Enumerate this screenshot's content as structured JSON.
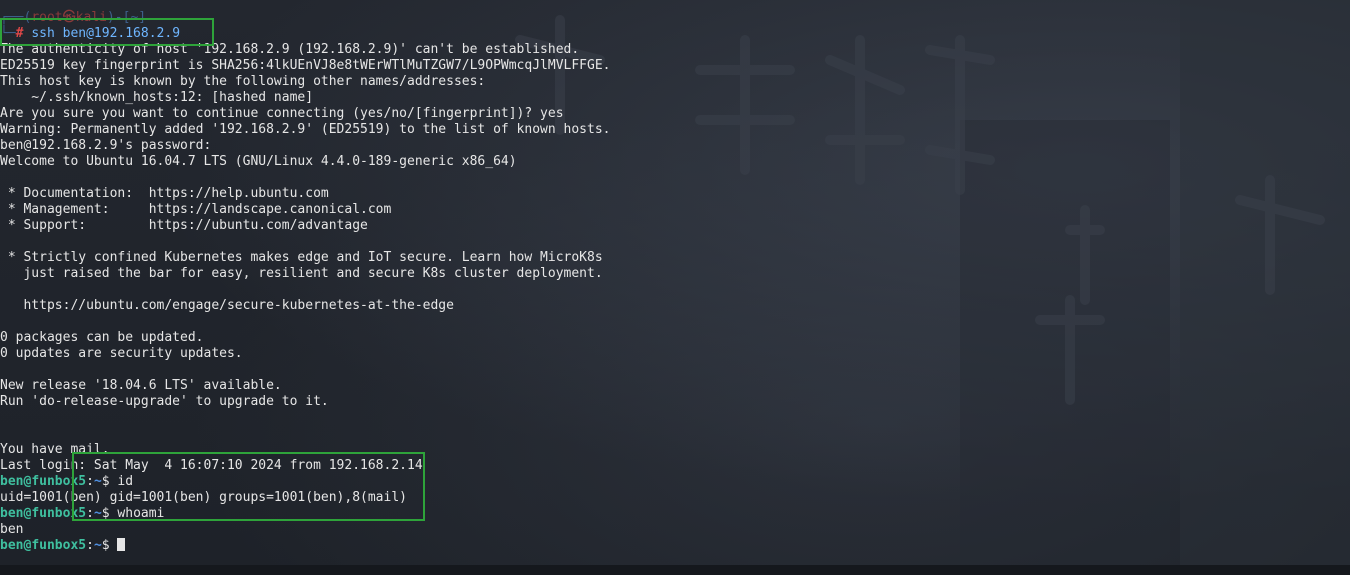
{
  "kali_prompt": {
    "open": "┌──(",
    "user": "root",
    "at": "㉿",
    "host": "kali",
    "close": ")-[",
    "dir": "~",
    "end": "]",
    "branch": "└─",
    "hash": "#",
    "command": "ssh ben@192.168.2.9"
  },
  "output": [
    "The authenticity of host '192.168.2.9 (192.168.2.9)' can't be established.",
    "ED25519 key fingerprint is SHA256:4lkUEnVJ8e8tWErWTlMuTZGW7/L9OPWmcqJlMVLFFGE.",
    "This host key is known by the following other names/addresses:",
    "    ~/.ssh/known_hosts:12: [hashed name]",
    "Are you sure you want to continue connecting (yes/no/[fingerprint])? yes",
    "Warning: Permanently added '192.168.2.9' (ED25519) to the list of known hosts.",
    "ben@192.168.2.9's password: ",
    "Welcome to Ubuntu 16.04.7 LTS (GNU/Linux 4.4.0-189-generic x86_64)",
    "",
    " * Documentation:  https://help.ubuntu.com",
    " * Management:     https://landscape.canonical.com",
    " * Support:        https://ubuntu.com/advantage",
    "",
    " * Strictly confined Kubernetes makes edge and IoT secure. Learn how MicroK8s",
    "   just raised the bar for easy, resilient and secure K8s cluster deployment.",
    "",
    "   https://ubuntu.com/engage/secure-kubernetes-at-the-edge",
    "",
    "0 packages can be updated.",
    "0 updates are security updates.",
    "",
    "New release '18.04.6 LTS' available.",
    "Run 'do-release-upgrade' to upgrade to it.",
    "",
    "",
    "You have mail.",
    "Last login: Sat May  4 16:07:10 2024 from 192.168.2.14"
  ],
  "ben_prompt": {
    "user": "ben",
    "at": "@",
    "host": "funbox5",
    "colon": ":",
    "path": "~",
    "sym": "$ "
  },
  "session": {
    "cmd_id": "id",
    "id_output": "uid=1001(ben) gid=1001(ben) groups=1001(ben),8(mail)",
    "cmd_whoami": "whoami",
    "whoami_output": "ben"
  },
  "colors": {
    "highlight_border": "#2ea33a",
    "prompt_green": "#3fbf9f",
    "kali_hash_red": "#e04848",
    "background": "#1c2027"
  }
}
